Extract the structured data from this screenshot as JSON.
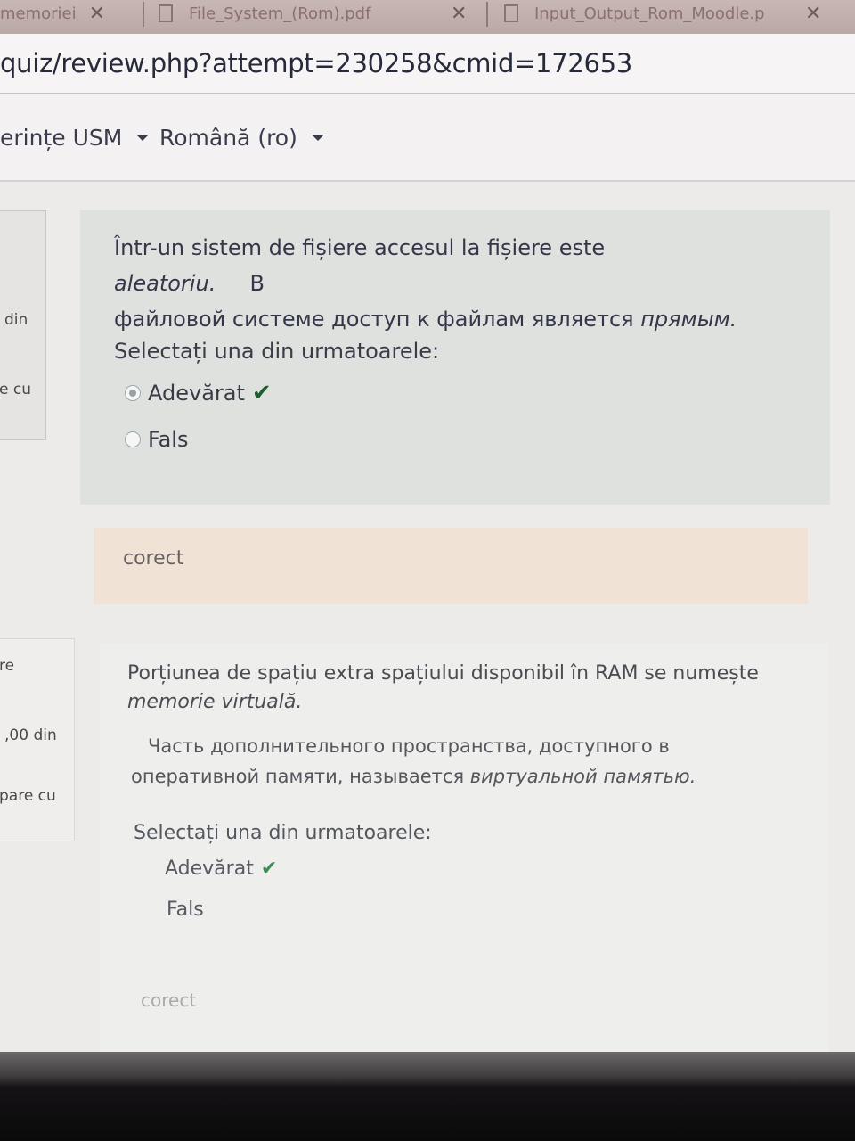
{
  "tabs": [
    {
      "label": "memoriei",
      "close": "✕"
    },
    {
      "label": "File_System_(Rom).pdf",
      "close": "✕"
    },
    {
      "label": "Input_Output_Rom_Moodle.p",
      "close": "✕"
    }
  ],
  "address": {
    "url": "quiz/review.php?attempt=230258&cmid=172653"
  },
  "navbar": {
    "item1": "erințe USM",
    "language": "Română (ro)"
  },
  "sidebar": {
    "q1_lines": [
      "din",
      "e cu"
    ],
    "q2_lines": [
      "re",
      ",00 din",
      "pare cu"
    ]
  },
  "question1": {
    "text_ro_before": "Într-un sistem de fișiere accesul la fișiere este ",
    "text_ro_em": "aleatoriu.",
    "text_ru_lead": "В",
    "text_ru": "файловой системе доступ к файлам  является ",
    "text_ru_em": "прямым.",
    "prompt": "Selectați una din urmatoarele:",
    "options": [
      {
        "label": "Adevărat",
        "selected": true,
        "correct": true
      },
      {
        "label": "Fals",
        "selected": false,
        "correct": false
      }
    ],
    "check_icon": "check-icon",
    "feedback": "corect"
  },
  "question2": {
    "text_ro": "Porțiunea de spațiu extra spațiului disponibil în RAM se numește",
    "text_ro_em": "memorie virtuală.",
    "text_ru": "Часть дополнительного пространства, доступного в",
    "text_ru2": "оперативной памяти, называется ",
    "text_ru_em": "виртуальной памятью.",
    "prompt": "Selectați una din urmatoarele:",
    "options": [
      {
        "label": "Adevărat",
        "correct": true
      },
      {
        "label": "Fals",
        "correct": false
      }
    ],
    "feedback": "corect"
  },
  "colors": {
    "correct_check": "#1f5e2f",
    "feedback_bg": "#f0e3d6",
    "question_bg": "#dfe1df"
  }
}
